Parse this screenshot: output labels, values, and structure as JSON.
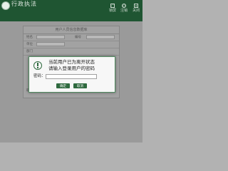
{
  "header": {
    "title": "行政执法",
    "subtitle": "",
    "lock_label": "锁屏",
    "power_label": "注销",
    "close_label": "关闭"
  },
  "panel": {
    "title": "用户人员信息数据库",
    "rows": [
      {
        "label": "姓名",
        "label2": "编号"
      },
      {
        "label": "单位",
        "label2": ""
      },
      {
        "label": "部门",
        "label2": ""
      },
      {
        "label": "职务",
        "label2": ""
      }
    ]
  },
  "modal": {
    "message_line1": "当前用户已为离开状态",
    "message_line2": "请输入登录用户的密码",
    "password_label": "密码：",
    "password_value": "",
    "confirm_label": "确定",
    "cancel_label": "取消"
  },
  "colors": {
    "header_bg": "#1f5532",
    "accent": "#2f6a3f"
  },
  "icons": [
    "logo-icon",
    "lock-icon",
    "power-icon",
    "close-icon",
    "warning-icon"
  ]
}
